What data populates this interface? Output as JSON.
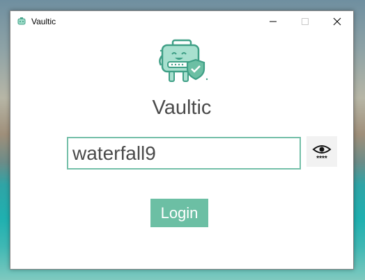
{
  "window": {
    "title": "Vaultic",
    "icon": "robot-icon"
  },
  "app": {
    "name": "Vaultic",
    "logo": "robot-safe-shield-logo"
  },
  "password": {
    "value": "waterfall9",
    "toggle_icon": "eye-icon",
    "toggle_hint": "****"
  },
  "actions": {
    "login_label": "Login"
  },
  "colors": {
    "accent": "#6cbfa4",
    "input_border": "#74bfa8",
    "text": "#4a4a4a"
  }
}
